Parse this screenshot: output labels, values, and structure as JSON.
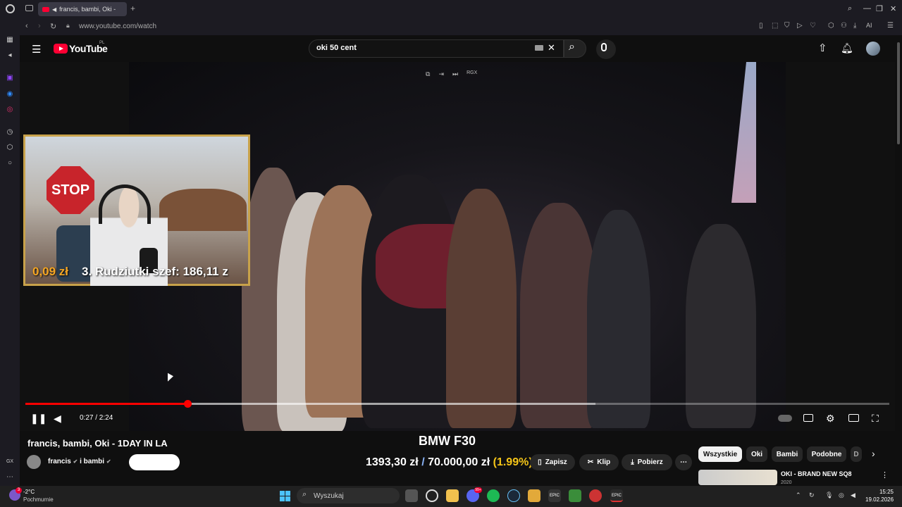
{
  "browser": {
    "tab_title": "francis, bambi, Oki - ",
    "url": "www.youtube.com/watch",
    "sidebar_gx": "GX"
  },
  "youtube": {
    "logo_text": "YouTube",
    "country_code": "PL",
    "search_query": "oki 50 cent",
    "player": {
      "time_current": "0:27",
      "time_total": "2:24",
      "time_display": "0:27 / 2:24",
      "progress_fraction": 0.1875,
      "buffered_fraction": 0.66,
      "top_control_label": "RGX"
    },
    "stream_overlay": {
      "stop_sign": "STOP",
      "donation_amount": "0,09 zł",
      "donor_line": "3. Rudziutki szef: 186,11 z"
    },
    "donation_goal": {
      "title": "BMW F30",
      "current": "1393,30 zł",
      "separator": "/",
      "target": "70.000,00 zł",
      "percent": "(1.99%)"
    },
    "video": {
      "title": "francis, bambi, Oki - 1DAY IN LA",
      "channel": "francis",
      "channel_and": "i bambi"
    },
    "actions": [
      {
        "label": "Zapisz",
        "icon": "bookmark-icon"
      },
      {
        "label": "Klip",
        "icon": "scissors-icon"
      },
      {
        "label": "Pobierz",
        "icon": "download-icon"
      }
    ],
    "chips": [
      "Wszystkie",
      "Oki",
      "Bambi",
      "Podobne",
      "D"
    ],
    "recommendation": {
      "title": "OKI - BRAND NEW SQ8",
      "subtitle": "2020"
    }
  },
  "taskbar": {
    "weather_temp": "-2°C",
    "weather_desc": "Pochmurnie",
    "weather_badge": "3",
    "search_placeholder": "Wyszukaj",
    "time": "15:25",
    "date": "19.02.2026",
    "discord_badge": "99+"
  },
  "colors": {
    "yt_red": "#ff0033",
    "progress_red": "#ff0000",
    "goal_percent": "#f5c518",
    "overlay_gold": "#f5a623"
  }
}
